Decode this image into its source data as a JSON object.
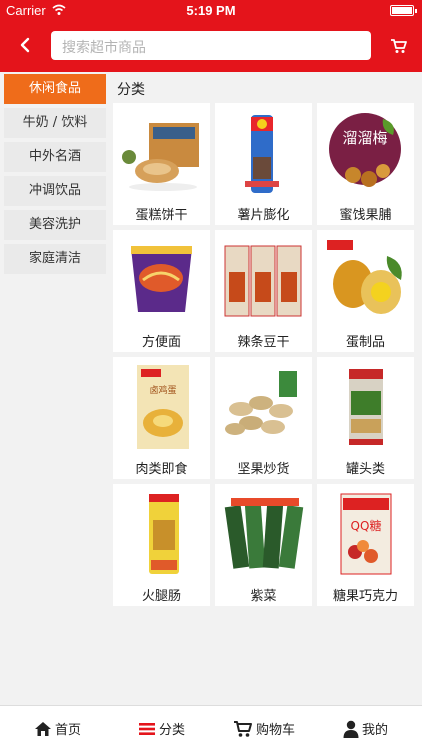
{
  "status": {
    "carrier": "Carrier",
    "time": "5:19 PM"
  },
  "search": {
    "placeholder": "搜索超市商品"
  },
  "sidebar": {
    "items": [
      {
        "label": "休闲食品",
        "active": true
      },
      {
        "label": "牛奶 / 饮料",
        "active": false
      },
      {
        "label": "中外名酒",
        "active": false
      },
      {
        "label": "冲调饮品",
        "active": false
      },
      {
        "label": "美容洗护",
        "active": false
      },
      {
        "label": "家庭清洁",
        "active": false
      }
    ]
  },
  "main": {
    "section_title": "分类",
    "categories": [
      {
        "label": "蛋糕饼干"
      },
      {
        "label": "薯片膨化"
      },
      {
        "label": "蜜饯果脯"
      },
      {
        "label": "方便面"
      },
      {
        "label": "辣条豆干"
      },
      {
        "label": "蛋制品"
      },
      {
        "label": "肉类即食"
      },
      {
        "label": "坚果炒货"
      },
      {
        "label": "罐头类"
      },
      {
        "label": "火腿肠"
      },
      {
        "label": "紫菜"
      },
      {
        "label": "糖果巧克力"
      }
    ]
  },
  "tabbar": {
    "items": [
      {
        "label": "首页",
        "icon": "home-icon"
      },
      {
        "label": "分类",
        "icon": "list-icon",
        "active": true
      },
      {
        "label": "购物车",
        "icon": "cart-icon"
      },
      {
        "label": "我的",
        "icon": "user-icon"
      }
    ]
  },
  "colors": {
    "brand_red": "#e4141b",
    "active_orange": "#ef6c1a"
  }
}
